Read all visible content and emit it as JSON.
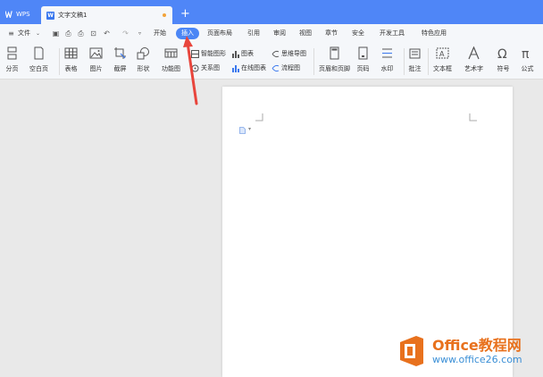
{
  "titlebar": {
    "app_tab": "WPS",
    "doc_tab": "文字文稿1",
    "new_tab": "+"
  },
  "menu": {
    "file": "文件",
    "items": [
      "开始",
      "插入",
      "页面布局",
      "引用",
      "审阅",
      "视图",
      "章节",
      "安全",
      "开发工具",
      "特色应用"
    ],
    "active": "插入"
  },
  "ribbon": {
    "page_break": "分页",
    "blank_page": "空白页",
    "table": "表格",
    "picture": "图片",
    "screenshot": "截屏",
    "shape": "形状",
    "function_chart": "功能图",
    "smart_graphic": "智能图形",
    "relation_graph": "关系图",
    "chart": "图表",
    "online_chart": "在线图表",
    "mind_map": "思维导图",
    "flow_chart": "流程图",
    "header_footer": "页眉和页脚",
    "page_number": "页码",
    "watermark": "水印",
    "comment": "批注",
    "text_box": "文本框",
    "word_art": "艺术字",
    "symbol": "符号",
    "formula": "公式"
  },
  "watermark_brand": {
    "title": "Office教程网",
    "url": "www.office26.com"
  },
  "colors": {
    "titlebar": "#4f86f7",
    "active_tab": "#4b86f5",
    "arrow": "#e8453c",
    "brand_orange": "#e8711d"
  }
}
